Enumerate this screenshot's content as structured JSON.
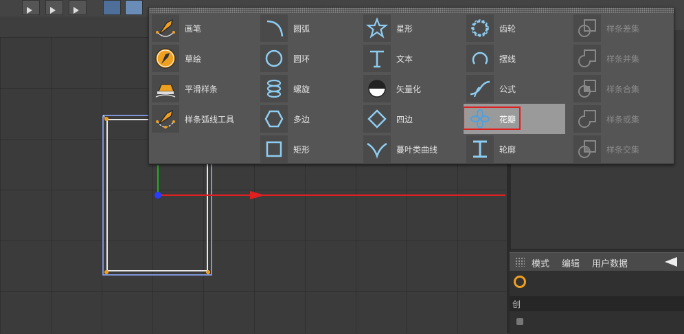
{
  "colors": {
    "spline_blue": "#8aa0e0",
    "spline_white": "#e8e8e8",
    "point_orange": "#f0a020",
    "axis_red": "#e02020",
    "axis_green": "#20b020",
    "origin_blue": "#2a3cff",
    "icon_blue": "#8ecdf2",
    "highlight_red": "#e02020"
  },
  "menu": {
    "columns": [
      {
        "items": [
          {
            "label": "画笔",
            "icon": "pen-tool-icon"
          },
          {
            "label": "草绘",
            "icon": "sketch-icon"
          },
          {
            "label": "平滑样条",
            "icon": "smooth-spline-icon"
          },
          {
            "label": "样条弧线工具",
            "icon": "spline-arc-tool-icon"
          }
        ]
      },
      {
        "items": [
          {
            "label": "圆弧",
            "icon": "arc-icon"
          },
          {
            "label": "圆环",
            "icon": "circle-icon"
          },
          {
            "label": "螺旋",
            "icon": "helix-icon"
          },
          {
            "label": "多边",
            "icon": "polygon-icon"
          },
          {
            "label": "矩形",
            "icon": "rectangle-icon"
          }
        ]
      },
      {
        "items": [
          {
            "label": "星形",
            "icon": "star-icon"
          },
          {
            "label": "文本",
            "icon": "text-icon"
          },
          {
            "label": "矢量化",
            "icon": "vectorizer-icon"
          },
          {
            "label": "四边",
            "icon": "4-side-icon"
          },
          {
            "label": "蔓叶类曲线",
            "icon": "cissoid-icon"
          }
        ]
      },
      {
        "items": [
          {
            "label": "齿轮",
            "icon": "cogwheel-icon"
          },
          {
            "label": "摆线",
            "icon": "cycloid-icon"
          },
          {
            "label": "公式",
            "icon": "formula-icon"
          },
          {
            "label": "花瓣",
            "icon": "flower-icon"
          },
          {
            "label": "轮廓",
            "icon": "profile-icon"
          }
        ]
      },
      {
        "items": [
          {
            "label": "样条差集",
            "icon": "spline-subtract-icon"
          },
          {
            "label": "样条并集",
            "icon": "spline-union-icon"
          },
          {
            "label": "样条合集",
            "icon": "spline-and-icon"
          },
          {
            "label": "样条或集",
            "icon": "spline-or-icon"
          },
          {
            "label": "样条交集",
            "icon": "spline-intersect-icon"
          }
        ]
      }
    ]
  },
  "attributes": {
    "menu_mode": "模式",
    "menu_edit": "编辑",
    "menu_user_data": "用户数据",
    "tab_partial": "创"
  }
}
